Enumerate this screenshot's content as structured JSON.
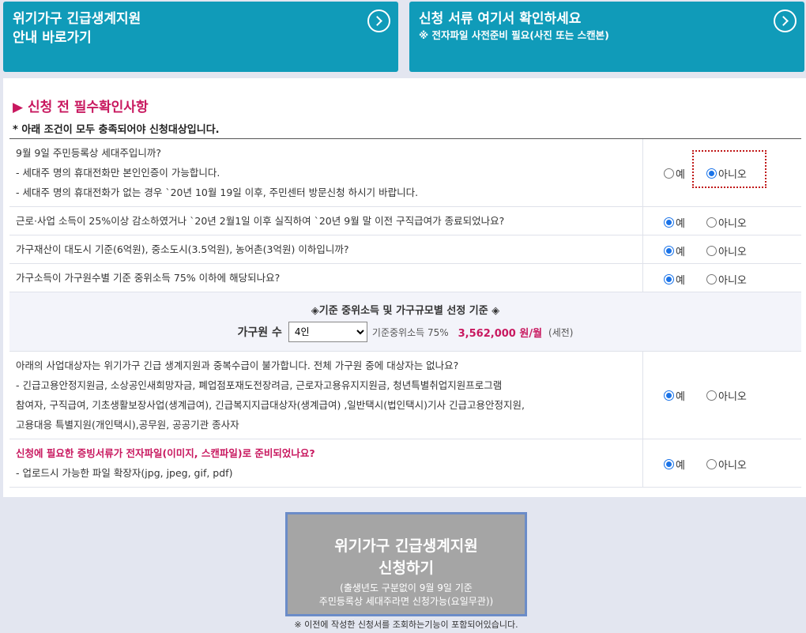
{
  "top_buttons": {
    "left": {
      "line1": "위기가구 긴급생계지원",
      "line2": "안내 바로가기"
    },
    "right": {
      "line1": "신청 서류 여기서 확인하세요",
      "line2": "※ 전자파일 사전준비 필요(사진 또는 스캔본)"
    }
  },
  "section": {
    "title": "▶ 신청 전 필수확인사항",
    "subnote": "* 아래 조건이 모두 충족되어야 신청대상입니다."
  },
  "options": {
    "yes": "예",
    "no": "아니오"
  },
  "questions": [
    {
      "lines": [
        "9월 9일 주민등록상 세대주입니까?",
        "- 세대주 명의 휴대전화만 본인인증이 가능합니다.",
        "- 세대주 명의 휴대전화가 없는 경우 `20년 10월 19일 이후, 주민센터 방문신청 하시기 바랍니다."
      ],
      "selected": "no"
    },
    {
      "lines": [
        "근로·사업 소득이 25%이상 감소하였거나 `20년 2월1일 이후 실직하여 `20년 9월 말 이전 구직급여가 종료되었나요?"
      ],
      "selected": "yes"
    },
    {
      "lines": [
        "가구재산이 대도시 기준(6억원), 중소도시(3.5억원), 농어촌(3억원) 이하입니까?"
      ],
      "selected": "yes"
    },
    {
      "lines": [
        "가구소득이 가구원수별 기준 중위소득 75% 이하에 해당되나요?"
      ],
      "selected": "yes"
    }
  ],
  "criteria": {
    "title": "◈기준 중위소득 및 가구규모별 선정 기준 ◈",
    "household_label": "가구원 수",
    "household_value": "4인",
    "median_label": "기준중위소득 75%",
    "amount": "3,562,000 원/월",
    "tax": "(세전)"
  },
  "questions2": [
    {
      "lines": [
        "아래의 사업대상자는 위기가구 긴급 생계지원과 중복수급이 불가합니다. 전체 가구원 중에 대상자는 없나요?",
        "- 긴급고용안정지원금, 소상공인새희망자금, 폐업점포재도전장려금, 근로자고용유지지원금, 청년특별취업지원프로그램",
        "참여자, 구직급여, 기초생활보장사업(생계급여), 긴급복지지급대상자(생계급여) ,일반택시(법인택시)기사 긴급고용안정지원,",
        "고용대응 특별지원(개인택시),공무원, 공공기관 종사자"
      ],
      "selected": "yes"
    },
    {
      "red": "신청에 필요한 증빙서류가 전자파일(이미지, 스캔파일)로 준비되었나요?",
      "lines": [
        "- 업로드시 가능한 파일 확장자(jpg, jpeg, gif, pdf)"
      ],
      "selected": "yes"
    }
  ],
  "apply_button": {
    "line1": "위기가구 긴급생계지원",
    "line2": "신청하기",
    "line3": "(출생년도 구분없이 9월 9일 기준",
    "line4": "주민등록상 세대주라면 신청가능(요일무관))"
  },
  "footnote": "※ 이전에 작성한 신청서를 조회하는기능이 포함되어있습니다."
}
